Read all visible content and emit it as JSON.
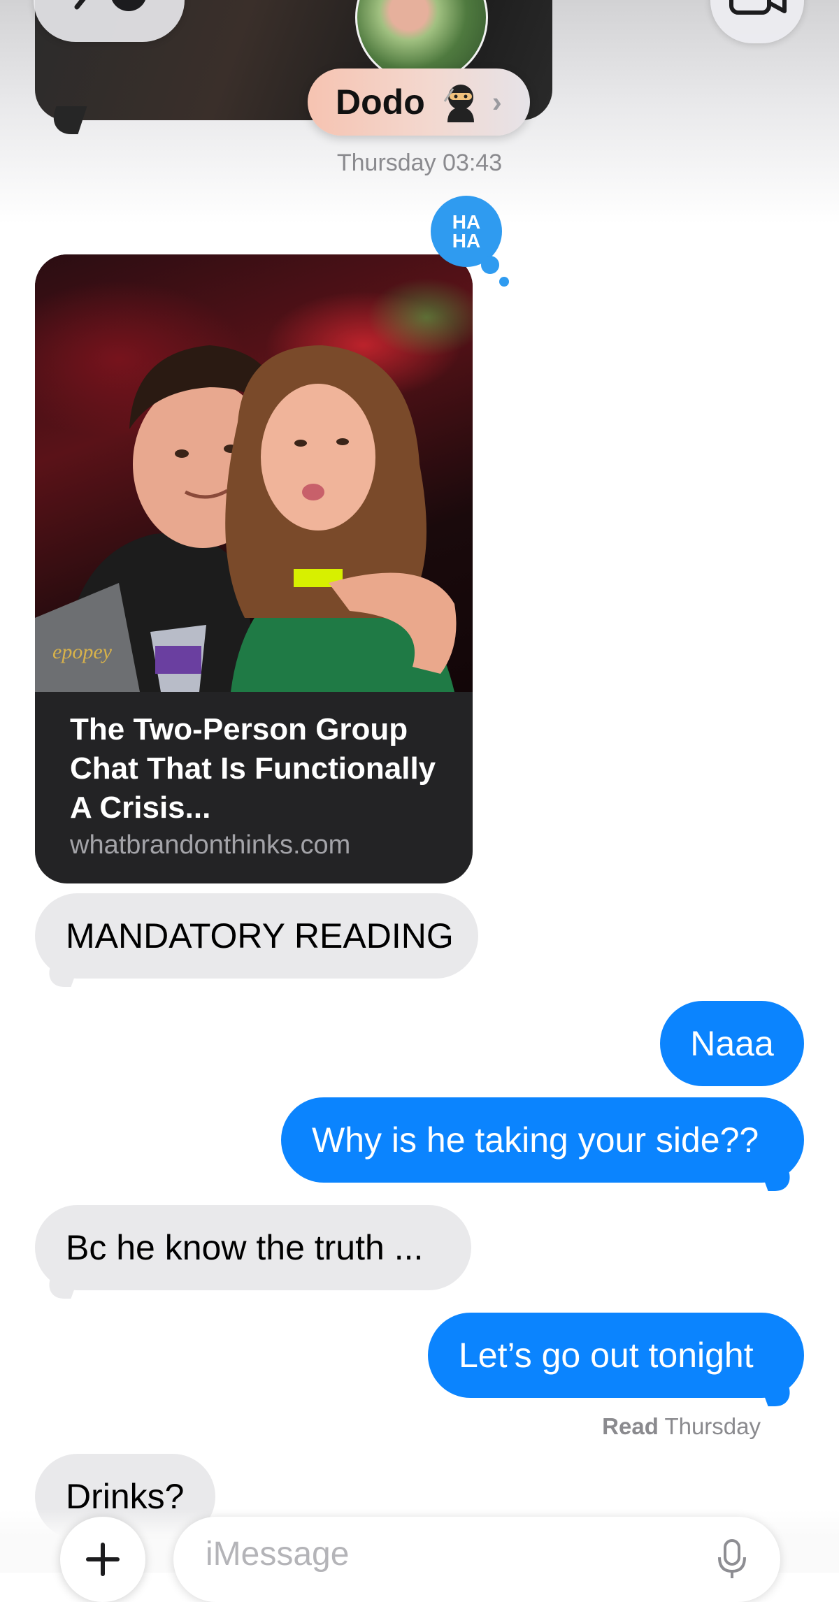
{
  "header": {
    "contact_name": "Dodo",
    "contact_emoji": "🥷",
    "back_icon": "chevron-left-icon",
    "video_icon": "video-camera-icon"
  },
  "thread": {
    "timestamp": "Thursday 03:43",
    "reaction": {
      "line1": "HA",
      "line2": "HA",
      "icon": "haha-reaction-icon",
      "color": "#2f9bf0"
    },
    "link_preview": {
      "title": "The Two-Person Group Chat That Is Functionally A Crisis...",
      "domain": "whatbrandonthinks.com"
    },
    "messages": [
      {
        "from": "them",
        "text": "MANDATORY READING"
      },
      {
        "from": "me",
        "text": "Naaa"
      },
      {
        "from": "me",
        "text": "Why is he taking your side??"
      },
      {
        "from": "them",
        "text": "Bc he know the truth ..."
      },
      {
        "from": "me",
        "text": "Let’s go out tonight"
      },
      {
        "from": "them",
        "text": "Drinks?"
      }
    ],
    "read_receipt": {
      "label": "Read",
      "time": "Thursday"
    }
  },
  "composer": {
    "placeholder": "iMessage",
    "plus_icon": "plus-icon",
    "mic_icon": "microphone-icon"
  },
  "colors": {
    "sent_bubble": "#0b84fe",
    "received_bubble": "#e9e9eb",
    "accent": "#0b84fe"
  }
}
